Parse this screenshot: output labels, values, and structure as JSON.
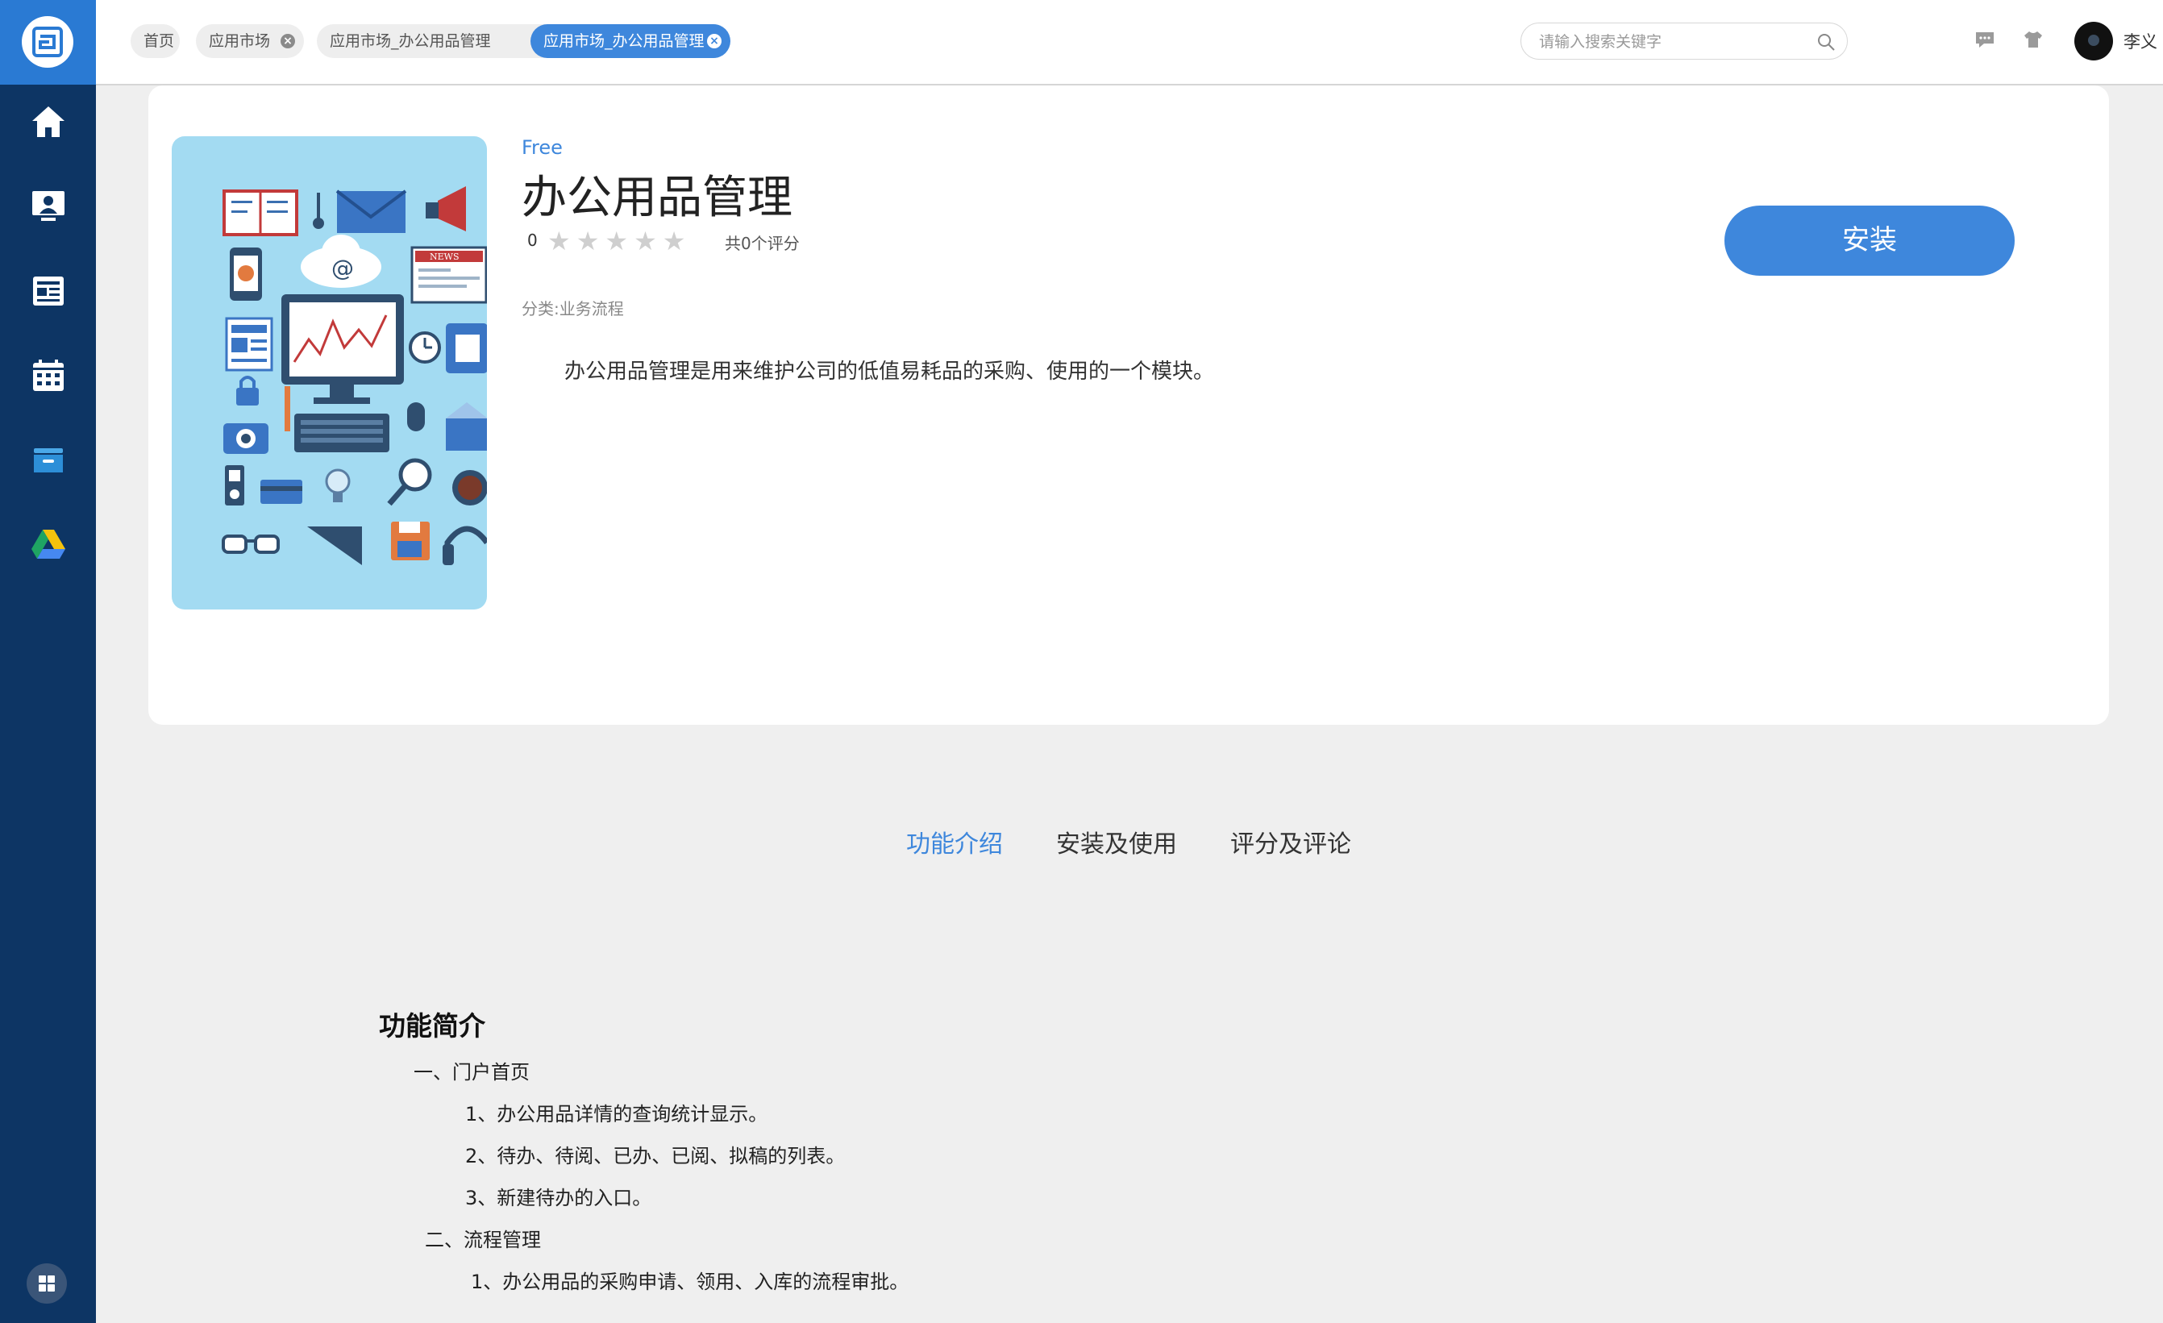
{
  "sidebar": {
    "items": [
      {
        "icon": "home-icon"
      },
      {
        "icon": "monitor-user-icon"
      },
      {
        "icon": "news-icon"
      },
      {
        "icon": "calendar-icon"
      },
      {
        "icon": "archive-box-icon"
      },
      {
        "icon": "drive-icon"
      }
    ],
    "bottom_icon": "grid-icon"
  },
  "topbar": {
    "tabs": [
      {
        "label": "首页",
        "closable": false
      },
      {
        "label": "应用市场",
        "closable": true
      },
      {
        "label": "应用市场_办公用品管理",
        "closable": true
      },
      {
        "label": "应用市场_办公用品管理",
        "closable": true,
        "active": true
      }
    ],
    "search": {
      "placeholder": "请输入搜索关键字",
      "value": ""
    },
    "user": {
      "name": "李义"
    }
  },
  "app": {
    "price": "Free",
    "title": "办公用品管理",
    "rating": "0",
    "stars_filled": 0,
    "stars_total": 5,
    "rating_count": "共0个评分",
    "category": "分类:业务流程",
    "description": "办公用品管理是用来维护公司的低值易耗品的采购、使用的一个模块。",
    "install_label": "安装"
  },
  "detail_tabs": [
    {
      "label": "功能介绍",
      "active": true
    },
    {
      "label": "安装及使用",
      "active": false
    },
    {
      "label": "评分及评论",
      "active": false
    }
  ],
  "intro": {
    "heading": "功能简介",
    "lines": [
      "一、门户首页",
      "1、办公用品详情的查询统计显示。",
      "2、待办、待阅、已办、已阅、拟稿的列表。",
      "3、新建待办的入口。",
      "二、流程管理",
      "1、办公用品的采购申请、领用、入库的流程审批。"
    ]
  },
  "colors": {
    "sidebar_bg": "#0d3564",
    "accent": "#3e87dc",
    "page_bg": "#efefef",
    "app_image_bg": "#a3dbf2"
  }
}
